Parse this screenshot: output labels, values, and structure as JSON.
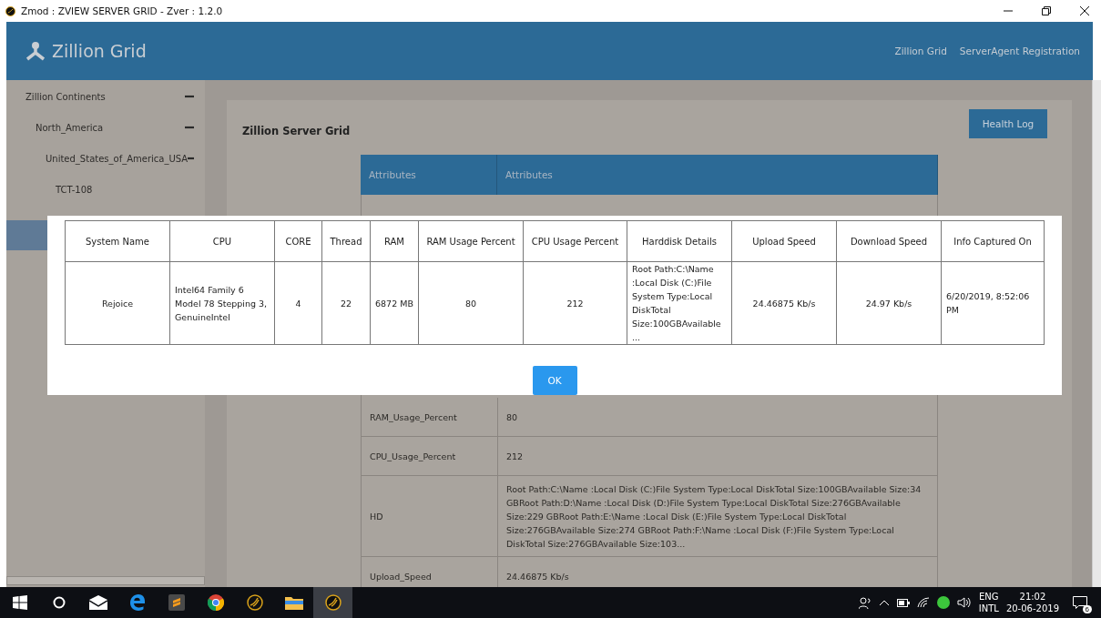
{
  "window": {
    "title": "Zmod : ZVIEW SERVER GRID - Zver : 1.2.0"
  },
  "header": {
    "brand": "Zillion Grid",
    "nav": [
      {
        "label": "Zillion Grid"
      },
      {
        "label": "ServerAgent Registration"
      }
    ]
  },
  "sidebar": {
    "tree": [
      {
        "label": "Zillion Continents",
        "expanded": true,
        "children": [
          {
            "label": "North_America",
            "expanded": true,
            "children": [
              {
                "label": "United_States_of_America_USA",
                "expanded": true,
                "children": [
                  {
                    "label": "TCT-108"
                  }
                ]
              }
            ]
          }
        ]
      }
    ]
  },
  "main": {
    "title": "Zillion Server Grid",
    "button": "Health Log",
    "attributes": {
      "columns": [
        "Attributes",
        "Attributes"
      ],
      "rows": [
        [
          "RAM_Usage_Percent",
          "80"
        ],
        [
          "CPU_Usage_Percent",
          "212"
        ],
        [
          "HD",
          "Root Path:C:\\Name :Local Disk (C:)File System Type:Local DiskTotal Size:100GBAvailable Size:34 GBRoot Path:D:\\Name :Local Disk (D:)File System Type:Local DiskTotal Size:276GBAvailable Size:229 GBRoot Path:E:\\Name :Local Disk (E:)File System Type:Local DiskTotal Size:276GBAvailable Size:274 GBRoot Path:F:\\Name :Local Disk (F:)File System Type:Local DiskTotal Size:276GBAvailable Size:103..."
        ],
        [
          "Upload_Speed",
          "24.46875 Kb/s"
        ]
      ]
    }
  },
  "dialog": {
    "columns": [
      "System Name",
      "CPU",
      "CORE",
      "Thread",
      "RAM",
      "RAM Usage Percent",
      "CPU Usage Percent",
      "Harddisk Details",
      "Upload Speed",
      "Download Speed",
      "Info Captured On"
    ],
    "rows": [
      [
        "Rejoice",
        "Intel64 Family 6 Model 78 Stepping 3, GenuineIntel",
        "4",
        "22",
        "6872 MB",
        "80",
        "212",
        "Root Path:C:\\Name :Local Disk (C:)File System Type:Local DiskTotal Size:100GBAvailable ...",
        "24.46875 Kb/s",
        "24.97 Kb/s",
        "6/20/2019, 8:52:06 PM"
      ]
    ],
    "button": "OK"
  },
  "taskbar": {
    "apps": [
      {
        "kind": "start",
        "selected": false
      },
      {
        "kind": "search",
        "selected": false
      },
      {
        "kind": "mail",
        "selected": false
      },
      {
        "kind": "edge",
        "selected": false
      },
      {
        "kind": "sublime",
        "selected": false
      },
      {
        "kind": "chrome",
        "selected": false
      },
      {
        "kind": "zmod",
        "selected": false
      },
      {
        "kind": "folder",
        "selected": false
      },
      {
        "kind": "zmod",
        "selected": true
      }
    ],
    "language": [
      "ENG",
      "INTL"
    ],
    "time": "21:02",
    "date": "20-06-2019",
    "notifications": "6"
  }
}
